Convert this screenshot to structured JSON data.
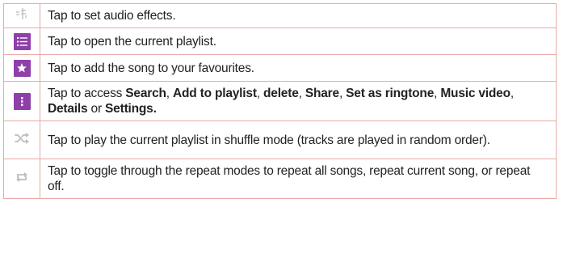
{
  "rows": [
    {
      "icon": "audio-effects-icon",
      "text": "Tap to set audio effects."
    },
    {
      "icon": "playlist-icon",
      "text": "Tap to open the current playlist."
    },
    {
      "icon": "favourite-star-icon",
      "text": "Tap to add the song to your favourites."
    },
    {
      "icon": "menu-more-icon",
      "text_prefix": "Tap to access ",
      "options": [
        "Search",
        "Add to playlist",
        "delete",
        "Share",
        "Set as ringtone",
        "Music video",
        "Details"
      ],
      "last_option": "Settings.",
      "sep": ", ",
      "or": " or "
    },
    {
      "icon": "shuffle-icon",
      "text": "Tap to play the current playlist in shuffle mode (tracks are played in random order)."
    },
    {
      "icon": "repeat-icon",
      "text": "Tap to toggle through the repeat modes to repeat all songs, repeat current song, or repeat off."
    }
  ],
  "colors": {
    "accent": "#8e3fa8",
    "border": "#e9a9a5",
    "muted_icon": "#bdbdbd"
  }
}
